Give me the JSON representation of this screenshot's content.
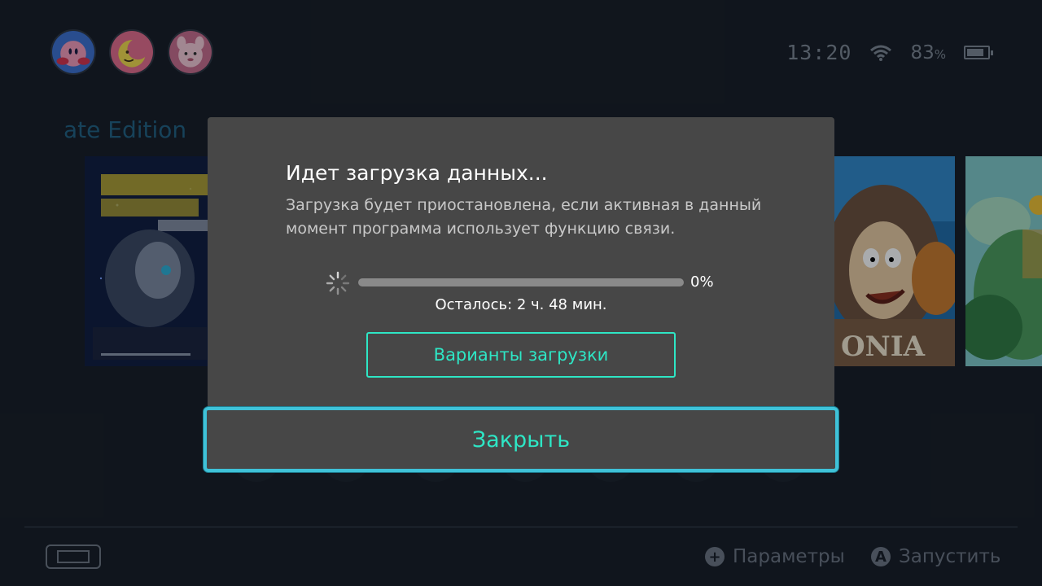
{
  "status": {
    "time": "13:20",
    "battery_percent": "83",
    "battery_unit": "%",
    "battery_level": 0.83,
    "icons": [
      "wifi-icon",
      "battery-icon"
    ]
  },
  "users": [
    {
      "name": "user-avatar-1",
      "icon": "kirby-avatar"
    },
    {
      "name": "user-avatar-2",
      "icon": "moon-avatar"
    },
    {
      "name": "user-avatar-3",
      "icon": "animal-crossing-avatar"
    }
  ],
  "home": {
    "selected_game_title": "ate Edition",
    "tiles": [
      {
        "id": "borderlands",
        "icon": "borderlands-tile"
      },
      {
        "id": "deponia",
        "icon": "deponia-tile"
      },
      {
        "id": "island-game",
        "icon": "island-game-tile"
      }
    ]
  },
  "dialog": {
    "title": "Идет загрузка данных...",
    "message": "Загрузка будет приостановлена, если активная в данный момент программа использует функцию связи.",
    "progress_percent_text": "0%",
    "progress": 0,
    "remaining": "Осталось: 2 ч. 48 мин.",
    "options_button": "Варианты загрузки",
    "close_button": "Закрыть"
  },
  "footer": {
    "options_glyph": "+",
    "options_label": "Параметры",
    "launch_glyph": "A",
    "launch_label": "Запустить"
  },
  "colors": {
    "accent": "#2ee6c5",
    "focus_border": "#3fc2d8",
    "dialog_bg": "#474747",
    "screen_bg": "#141a22"
  }
}
